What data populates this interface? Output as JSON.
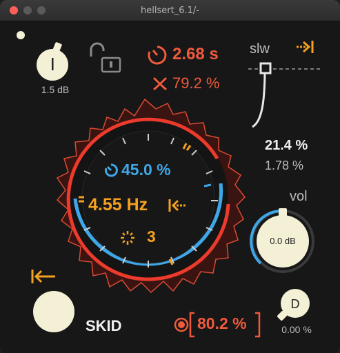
{
  "window": {
    "title": "hellsert_6.1/-"
  },
  "input_gain": {
    "label": "1.5 dB"
  },
  "time": {
    "value": "2.68 s"
  },
  "crossfade": {
    "value": "79.2 %"
  },
  "slew": {
    "label": "slw"
  },
  "side_values": {
    "a": "21.4 %",
    "b": "1.78 %"
  },
  "ring": {
    "percent": "45.0 %",
    "rate": "4.55 Hz",
    "count": "3"
  },
  "volume": {
    "label": "vol",
    "value": "0.0 dB"
  },
  "dry": {
    "letter": "D",
    "value": "0.00 %"
  },
  "skid": {
    "label": "SKID"
  },
  "ratio": {
    "value": "80.2 %"
  },
  "icons": [
    "lock-open-icon",
    "timer-icon",
    "crossfade-icon",
    "jump-right-icon",
    "jump-left-icon",
    "sync-icon",
    "voices-icon",
    "record-icon",
    "jump-back-icon"
  ],
  "colors": {
    "accent_red": "#f05a3c",
    "accent_orange": "#f4a020",
    "accent_blue": "#3fa7e8",
    "knob_cream": "#f4f0d6"
  }
}
